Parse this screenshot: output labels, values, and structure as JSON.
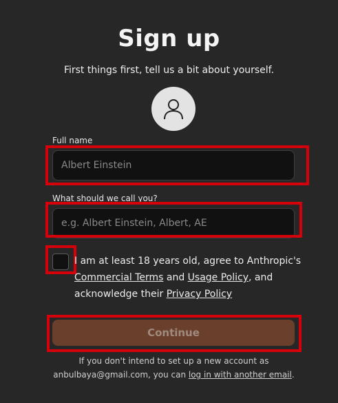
{
  "header": {
    "title": "Sign up",
    "subtitle": "First things first, tell us a bit about yourself."
  },
  "avatar": {
    "icon": "user-icon"
  },
  "full_name": {
    "label": "Full name",
    "value": "",
    "placeholder": "Albert Einstein"
  },
  "nickname": {
    "label": "What should we call you?",
    "value": "",
    "placeholder": "e.g. Albert Einstein, Albert, AE"
  },
  "consent": {
    "checked": false,
    "text_1": "I am at least 18 years old, agree to Anthropic's ",
    "commercial_terms": "Commercial Terms",
    "text_2": " and ",
    "usage_policy": "Usage Policy",
    "text_3": ", and acknowledge their ",
    "privacy_policy": "Privacy Policy"
  },
  "continue_button": {
    "label": "Continue"
  },
  "footer": {
    "text_1": "If you don't intend to set up a new account as anbulbaya@gmail.com, you can ",
    "link": "log in with another email",
    "text_2": "."
  },
  "colors": {
    "background": "#272727",
    "field_bg": "#111111",
    "button_bg": "#6a3f2b",
    "highlight": "#d6000a"
  }
}
